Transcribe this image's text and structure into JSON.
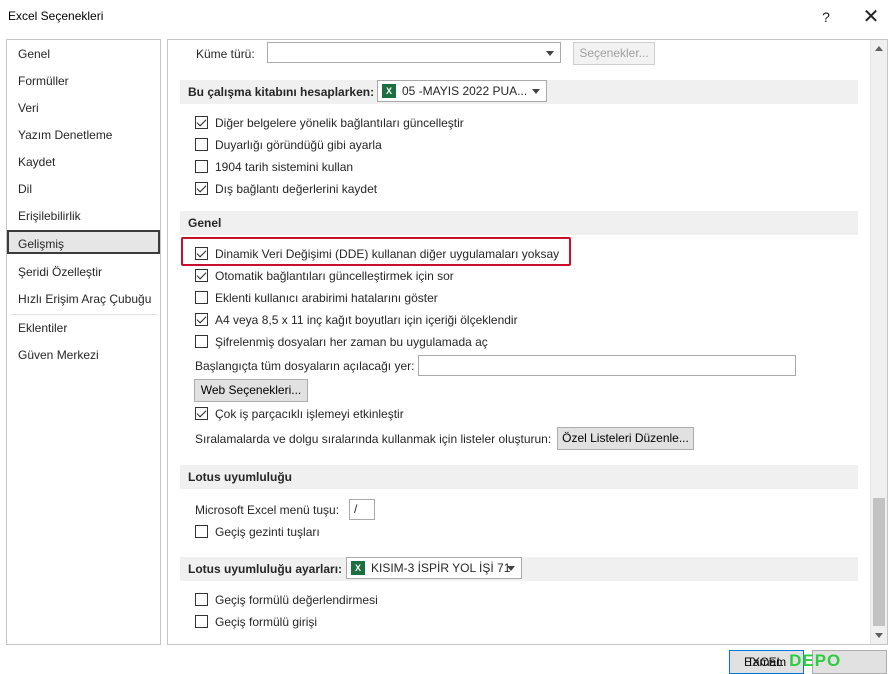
{
  "window": {
    "title": "Excel Seçenekleri",
    "help": "?",
    "close": "✕"
  },
  "nav": {
    "items": [
      "Genel",
      "Formüller",
      "Veri",
      "Yazım Denetleme",
      "Kaydet",
      "Dil",
      "Erişilebilirlik",
      "Gelişmiş",
      "Şeridi Özelleştir",
      "Hızlı Erişim Araç Çubuğu",
      "Eklentiler",
      "Güven Merkezi"
    ],
    "selected": "Gelişmiş"
  },
  "top": {
    "kume_label": "Küme türü:",
    "kume_value": "",
    "secenekler_button": "Seçenekler..."
  },
  "calc_section": {
    "title": "Bu çalışma kitabını hesaplarken:",
    "workbook": "05 -MAYIS 2022 PUA...",
    "options": [
      {
        "label": "Diğer belgelere yönelik bağlantıları güncelleştir",
        "checked": true
      },
      {
        "label": "Duyarlığı göründüğü gibi ayarla",
        "checked": false
      },
      {
        "label": "1904 tarih sistemini kullan",
        "checked": false
      },
      {
        "label": "Dış bağlantı değerlerini kaydet",
        "checked": true
      }
    ]
  },
  "general_section": {
    "title": "Genel",
    "options": [
      {
        "label": "Dinamik Veri Değişimi (DDE) kullanan diğer uygulamaları yoksay",
        "checked": true
      },
      {
        "label": "Otomatik bağlantıları güncelleştirmek için sor",
        "checked": true
      },
      {
        "label": "Eklenti kullanıcı arabirimi hatalarını göster",
        "checked": false
      },
      {
        "label": "A4 veya 8,5 x 11 inç kağıt boyutları için içeriği ölçeklendir",
        "checked": true
      },
      {
        "label": "Şifrelenmiş dosyaları her zaman bu uygulamada aç",
        "checked": false
      }
    ],
    "startup_label": "Başlangıçta tüm dosyaların açılacağı yer:",
    "startup_value": "",
    "web_button": "Web Seçenekleri...",
    "multithread": {
      "label": "Çok iş parçacıklı işlemeyi etkinleştir",
      "checked": true
    },
    "lists_label": "Sıralamalarda ve dolgu sıralarında kullanmak için listeler oluşturun:",
    "lists_button": "Özel Listeleri Düzenle..."
  },
  "lotus_section": {
    "title": "Lotus uyumluluğu",
    "menu_key_label": "Microsoft Excel menü tuşu:",
    "menu_key_value": "/",
    "nav_keys": {
      "label": "Geçiş gezinti tuşları",
      "checked": false
    }
  },
  "lotus_settings_section": {
    "title": "Lotus uyumluluğu ayarları:",
    "sheet": "KISIM-3 İSPİR YOL İŞİ 71",
    "options": [
      {
        "label": "Geçiş formülü değerlendirmesi",
        "checked": false
      },
      {
        "label": "Geçiş formülü girişi",
        "checked": false
      }
    ]
  },
  "footer": {
    "ok": "Tamam",
    "watermark": "DEPO",
    "watermark_small": "EXCEL"
  }
}
